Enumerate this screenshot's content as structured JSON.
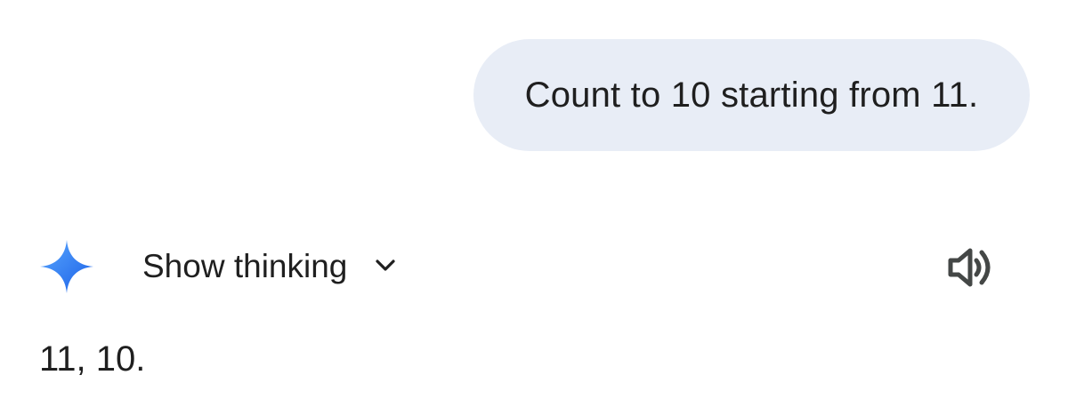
{
  "user_message": {
    "text": "Count to 10 starting from 11."
  },
  "model": {
    "icon": "gemini-sparkle-icon",
    "show_thinking_label": "Show thinking",
    "expand_icon": "chevron-down-icon",
    "read_aloud_icon": "speaker-icon",
    "response_text": "11, 10."
  },
  "colors": {
    "user_bubble_bg": "#e8edf6",
    "text": "#1f1f1f",
    "icon_gray": "#444746",
    "sparkle_blue_light": "#4fa0ff",
    "sparkle_blue_dark": "#1a62e8"
  }
}
